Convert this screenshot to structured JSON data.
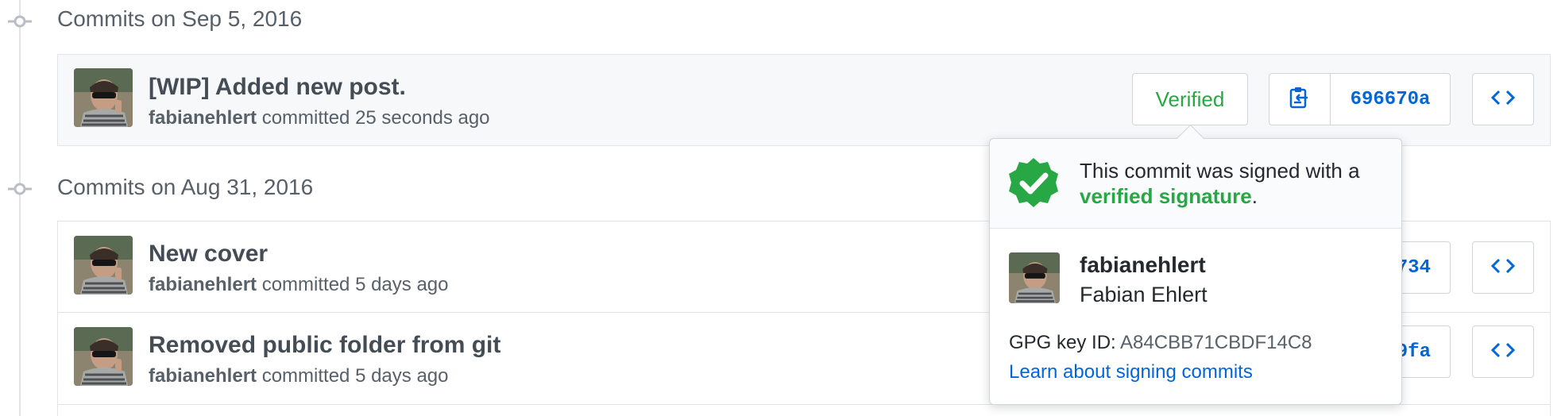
{
  "groups": [
    {
      "heading": "Commits on Sep 5, 2016",
      "commits": [
        {
          "title": "[WIP] Added new post.",
          "author": "fabianehlert",
          "meta": "committed 25 seconds ago",
          "verified_label": "Verified",
          "sha": "696670a"
        }
      ]
    },
    {
      "heading": "Commits on Aug 31, 2016",
      "commits": [
        {
          "title": "New cover",
          "author": "fabianehlert",
          "meta": "committed 5 days ago",
          "sha_visible": "734"
        },
        {
          "title": "Removed public folder from git",
          "author": "fabianehlert",
          "meta": "committed 5 days ago",
          "sha_visible": "9fa"
        }
      ]
    }
  ],
  "popover": {
    "message_prefix": "This commit was signed with a",
    "message_link": "verified signature",
    "message_suffix": ".",
    "signer_login": "fabianehlert",
    "signer_name": "Fabian Ehlert",
    "gpg_label": "GPG key ID:",
    "gpg_key_id": "A84CBB71CBDF14C8",
    "learn_link": "Learn about signing commits"
  },
  "icons": {
    "timeline": "git-commit-icon",
    "copy": "clippy-icon",
    "browse": "code-icon",
    "verified": "verified-badge-icon"
  },
  "colors": {
    "verified_green": "#28a745",
    "link_blue": "#0366d6",
    "muted": "#586069"
  }
}
